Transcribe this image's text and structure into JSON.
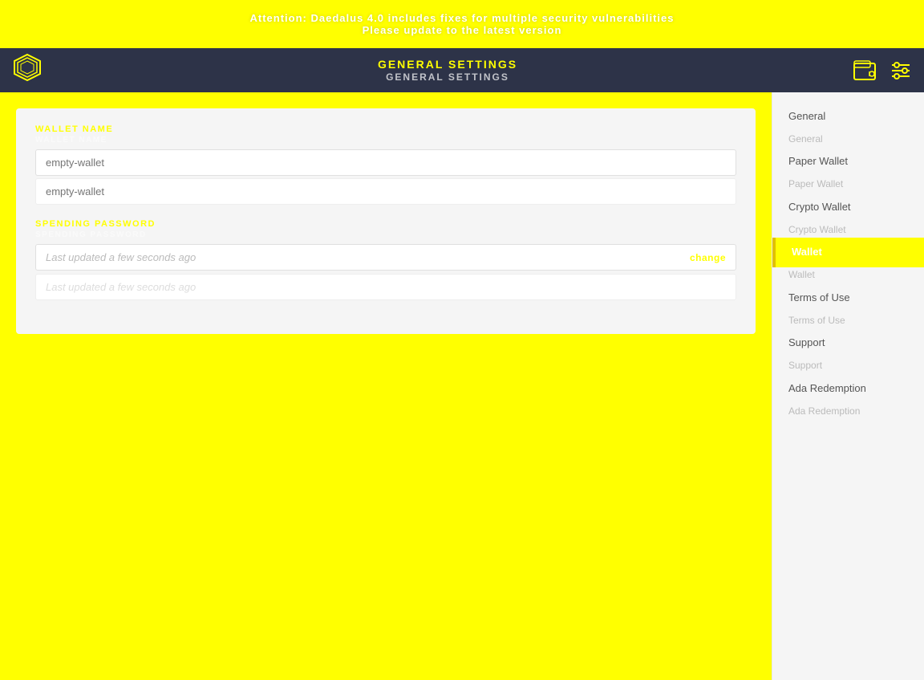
{
  "topBanner": {
    "line1": "Attention: Daedalus 4.0 includes fixes for multiple security vulnerabilities",
    "line2": "Please update to the latest version"
  },
  "navbar": {
    "title": "GENERAL SETTINGS",
    "subtitle": "GENERAL SETTINGS",
    "logoAlt": "Daedalus Logo"
  },
  "form": {
    "walletNameLabel": "WALLET NAME",
    "walletNameLabelShadow": "WALLET NAME",
    "walletNamePlaceholder": "empty-wallet",
    "walletNamePlaceholderShadow": "empty-wallet",
    "spendingPasswordLabel": "SPENDING PASSWORD",
    "spendingPasswordLabelShadow": "SPENDING PASSWORD",
    "spendingPassword1": "Last updated a few seconds ago",
    "spendingPassword2": "Last updated a few seconds ago",
    "changeLabel": "change",
    "changeLabelShadow": "change"
  },
  "sidebar": {
    "items": [
      {
        "label": "General",
        "shadow": "General",
        "active": false
      },
      {
        "label": "Paper Wallet",
        "shadow": "Paper Wallet",
        "active": false
      },
      {
        "label": "Crypto Wallet",
        "shadow": "Crypto Wallet",
        "active": false
      },
      {
        "label": "Wallet",
        "active": true
      },
      {
        "label": "Wallet",
        "shadow": "Wallet",
        "active": false
      },
      {
        "label": "Terms of Use",
        "shadow": "Terms of Use",
        "active": false
      },
      {
        "label": "Support",
        "shadow": "Support",
        "active": false
      },
      {
        "label": "Ada Redemption",
        "shadow": "Ada Redemption",
        "active": false
      }
    ]
  }
}
